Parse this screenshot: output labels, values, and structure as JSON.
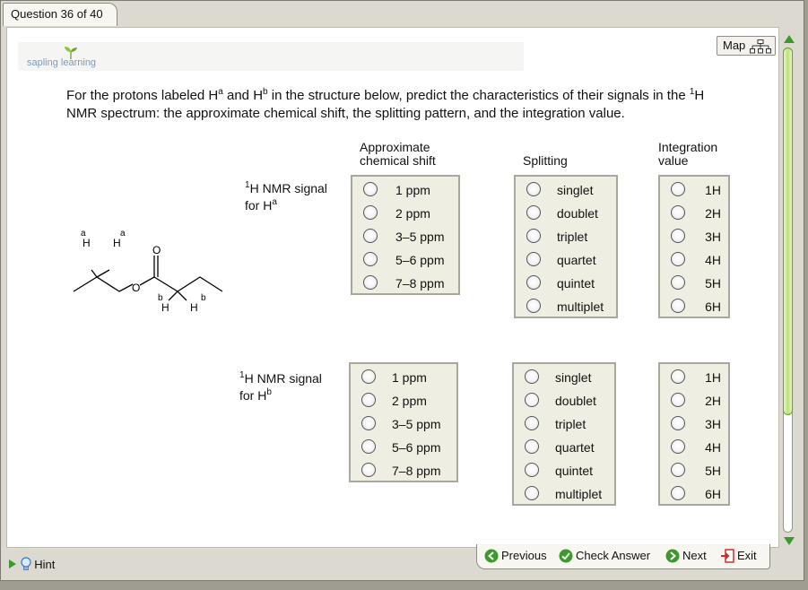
{
  "window": {
    "question_tab": "Question 36 of 40"
  },
  "brand": {
    "name": "sapling learning"
  },
  "map_button": {
    "label": "Map",
    "icon": "sitemap-icon"
  },
  "prompt": {
    "part1": "For the protons labeled H",
    "sup_a": "a",
    "part2": " and H",
    "sup_b": "b",
    "part3": " in the structure below, predict the characteristics of their signals in the ",
    "sup_1": "1",
    "part4": "H NMR spectrum: the approximate chemical shift, the splitting pattern, and the integration value."
  },
  "molecule": {
    "labels": {
      "ha1": "a",
      "ha2": "a",
      "h1": "H",
      "h2": "H",
      "o_carbonyl": "O",
      "o_ester": "O",
      "hb1": "b",
      "hb2": "b",
      "h3": "H",
      "h4": "H"
    }
  },
  "columns": {
    "shift_line1": "Approximate",
    "shift_line2": "chemical shift",
    "splitting": "Splitting",
    "integration_line1": "Integration",
    "integration_line2": "value"
  },
  "signals": [
    {
      "sup": "1",
      "line1": "H NMR signal",
      "line2": "for H",
      "line2_sup": "a"
    },
    {
      "sup": "1",
      "line1": "H NMR signal",
      "line2": "for H",
      "line2_sup": "b"
    }
  ],
  "shift_options": [
    "1 ppm",
    "2 ppm",
    "3–5 ppm",
    "5–6 ppm",
    "7–8 ppm"
  ],
  "splitting_options": [
    "singlet",
    "doublet",
    "triplet",
    "quartet",
    "quintet",
    "multiplet"
  ],
  "integration_options": [
    "1H",
    "2H",
    "3H",
    "4H",
    "5H",
    "6H"
  ],
  "bottom": {
    "hint": "Hint",
    "previous": "Previous",
    "check_answer": "Check Answer",
    "next": "Next",
    "exit": "Exit"
  },
  "colors": {
    "accent_green": "#3c9a2c",
    "panel_bg": "#efeee2",
    "scroll_green": "#b9e27a",
    "exit_red": "#d22d2d"
  }
}
